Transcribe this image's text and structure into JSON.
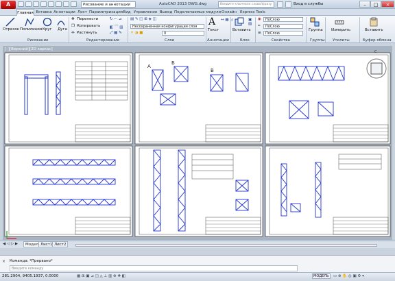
{
  "app": {
    "title": "AutoCAD 2013    DWG.dwg",
    "logo": "A"
  },
  "quick_access": {
    "workspace": "Рисование и аннотации"
  },
  "search": {
    "placeholder": "Введите ключевое слово/фразу"
  },
  "signin": {
    "label": "Вход в службы"
  },
  "tabs": [
    "Главная",
    "Вставка",
    "Аннотации",
    "Лист",
    "Параметризация",
    "Вид",
    "Управление",
    "Вывод",
    "Подключаемые модули",
    "Онлайн",
    "Express Tools"
  ],
  "active_tab": "Главная",
  "ribbon": {
    "draw": {
      "title": "Рисование",
      "line": "Отрезок",
      "polyline": "Полилиния",
      "circle": "Круг",
      "arc": "Дуга"
    },
    "modify": {
      "title": "Редактирование",
      "move": "Перенести",
      "copy": "Копировать",
      "stretch": "Растянуть"
    },
    "layers": {
      "title": "Слои",
      "layer_state": "Несохраненная конфигурация слоя",
      "layer_value": "0"
    },
    "annotation": {
      "title": "Аннотации",
      "text": "Текст"
    },
    "block": {
      "title": "Блок",
      "insert": "Вставить"
    },
    "properties": {
      "title": "Свойства",
      "color": "ПоСлою",
      "linetype": "ПоСлою",
      "lineweight": "ПоСлою"
    },
    "groups": {
      "title": "Группы",
      "group": "Группа"
    },
    "utilities": {
      "title": "Утилиты",
      "measure": "Измерить"
    },
    "clipboard": {
      "title": "Буфер обмена",
      "paste": "Вставить"
    }
  },
  "viewport": {
    "label": "[–][Верхний][2D каркас]",
    "compass": "С"
  },
  "layout_tabs": [
    "Модель",
    "Лист1",
    "Лист2"
  ],
  "command": {
    "history": "Команда: *Прервано*",
    "input_placeholder": "Введите команду"
  },
  "status": {
    "coordinates": "281.2904, 9405.1937, 0.0000",
    "model": "МОДЕЛЬ"
  }
}
